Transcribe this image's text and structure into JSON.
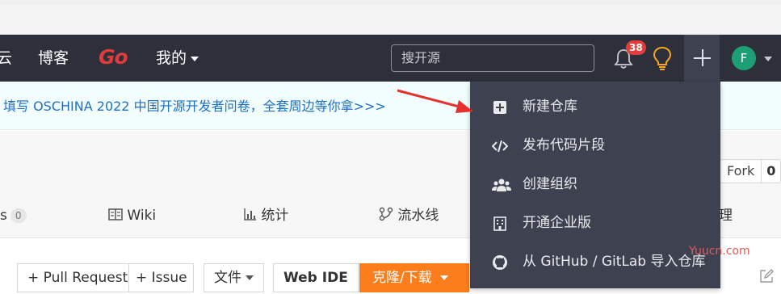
{
  "navbar": {
    "item_cut": "云",
    "blog": "博客",
    "go": "Go",
    "mine": "我的",
    "search_placeholder": "搜开源",
    "notification_count": "38",
    "avatar_letter": "F"
  },
  "banner": {
    "text": "填写 OSCHINA 2022 中国开源开发者问卷，全套周边等你拿>>>"
  },
  "repo": {
    "fork_label": "Fork",
    "fork_count": "0",
    "tabs": [
      {
        "label": "s",
        "count": "0"
      },
      {
        "label": "Wiki"
      },
      {
        "label": "统计"
      },
      {
        "label": "流水线"
      },
      {
        "label": "理"
      }
    ],
    "buttons": {
      "pull_request": "+ Pull Request",
      "issue": "+ Issue",
      "file": "文件",
      "web_ide": "Web IDE",
      "clone": "克隆/下载"
    }
  },
  "dropdown": {
    "items": [
      {
        "label": "新建仓库",
        "icon": "plus-square-icon"
      },
      {
        "label": "发布代码片段",
        "icon": "code-icon"
      },
      {
        "label": "创建组织",
        "icon": "users-icon"
      },
      {
        "label": "开通企业版",
        "icon": "building-icon"
      },
      {
        "label": "从 GitHub / GitLab 导入仓库",
        "icon": "github-icon"
      }
    ]
  },
  "watermark": "Yuucn.com",
  "colors": {
    "navbar_bg": "#2d2f3a",
    "dropdown_bg": "#3e4150",
    "go_red": "#e03a3a",
    "badge_red": "#e23c3c",
    "clone_orange": "#fb7d1c",
    "banner_link": "#1e6fc4",
    "avatar_green": "#1e9e74",
    "arrow_red": "#e5302d"
  }
}
